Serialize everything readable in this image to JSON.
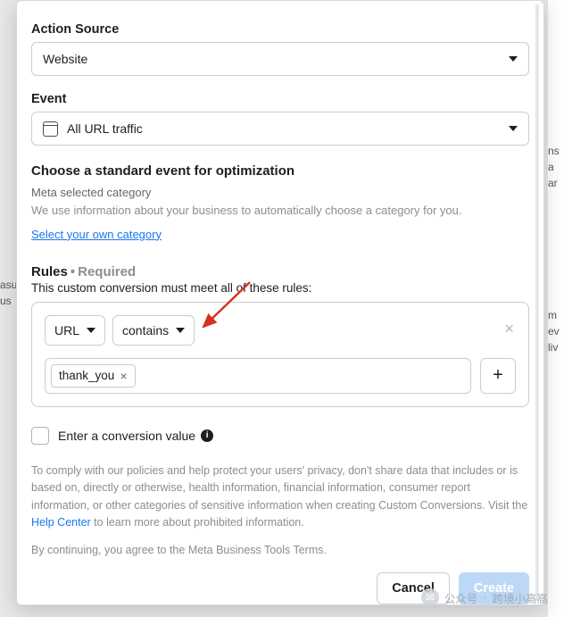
{
  "action_source": {
    "label": "Action Source",
    "value": "Website"
  },
  "event": {
    "label": "Event",
    "value": "All URL traffic"
  },
  "standard_event": {
    "heading": "Choose a standard event for optimization",
    "meta_category": "Meta selected category",
    "description": "We use information about your business to automatically choose a category for you.",
    "select_own_link": "Select your own category"
  },
  "rules": {
    "label": "Rules",
    "required": "Required",
    "subtext": "This custom conversion must meet all of these rules:",
    "parameter": "URL",
    "operator": "contains",
    "chips": [
      "thank_you"
    ]
  },
  "conversion_value": {
    "checkbox_label": "Enter a conversion value"
  },
  "policy": {
    "text_part1": "To comply with our policies and help protect your users' privacy, don't share data that includes or is based on, directly or otherwise, health information, financial information, consumer report information, or other categories of sensitive information when creating Custom Conversions. Visit the ",
    "help_center": "Help Center",
    "text_part2": " to learn more about prohibited information.",
    "continuing_prefix": "By continuing, you agree to the ",
    "terms_link": "Meta Business Tools Terms."
  },
  "footer": {
    "cancel": "Cancel",
    "create": "Create"
  },
  "background": {
    "left_line1": "asu",
    "left_line2": "us",
    "right_line1": "ns",
    "right_line2": "a ar",
    "right_line3": "m",
    "right_line4": "ev",
    "right_line5": "liv"
  },
  "watermark": {
    "prefix": "公众号",
    "name": "跨境小高高"
  }
}
